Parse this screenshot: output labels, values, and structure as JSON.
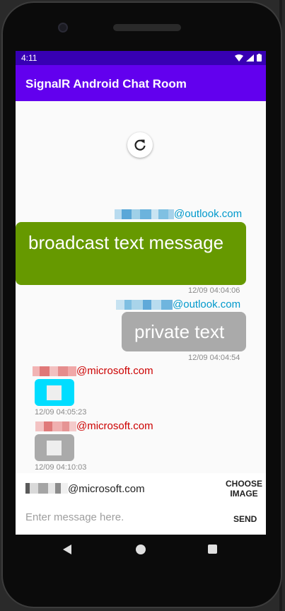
{
  "status_bar": {
    "time": "4:11"
  },
  "app_bar": {
    "title": "SignalR Android Chat Room"
  },
  "messages": [
    {
      "sender_suffix": "@outlook.com",
      "text": "broadcast text message",
      "time": "12/09 04:04:06",
      "type": "broadcast",
      "color": "#669900"
    },
    {
      "sender_suffix": "@outlook.com",
      "text": "private text",
      "time": "12/09 04:04:54",
      "type": "private",
      "color": "#aaaaaa"
    },
    {
      "sender_suffix": "@microsoft.com",
      "time": "12/09 04:05:23",
      "type": "image",
      "color": "#00ddff"
    },
    {
      "sender_suffix": "@microsoft.com",
      "time": "12/09 04:10:03",
      "type": "image",
      "color": "#aaaaaa"
    }
  ],
  "composer": {
    "current_user_suffix": "@microsoft.com",
    "choose_image_label": "CHOOSE IMAGE",
    "message_placeholder": "Enter message here.",
    "send_label": "SEND"
  },
  "colors": {
    "status_bar": "#3700b3",
    "app_bar": "#6200ee",
    "outlook_sender": "#0099cc",
    "microsoft_sender": "#cc0000"
  }
}
